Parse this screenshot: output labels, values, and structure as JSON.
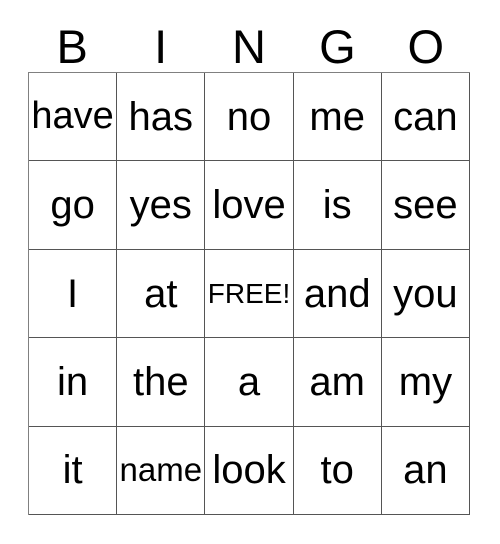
{
  "card": {
    "header_letters": [
      "B",
      "I",
      "N",
      "G",
      "O"
    ],
    "free_space_label": "FREE!",
    "colors": {
      "background": "#ffffff",
      "text": "#000000",
      "grid_line": "#555555",
      "grid_line_outer": "#808080"
    },
    "rows": [
      {
        "cells": [
          {
            "text": "have",
            "free": false
          },
          {
            "text": "has",
            "free": false
          },
          {
            "text": "no",
            "free": false
          },
          {
            "text": "me",
            "free": false
          },
          {
            "text": "can",
            "free": false
          }
        ]
      },
      {
        "cells": [
          {
            "text": "go",
            "free": false
          },
          {
            "text": "yes",
            "free": false
          },
          {
            "text": "love",
            "free": false
          },
          {
            "text": "is",
            "free": false
          },
          {
            "text": "see",
            "free": false
          }
        ]
      },
      {
        "cells": [
          {
            "text": "I",
            "free": false
          },
          {
            "text": "at",
            "free": false
          },
          {
            "text": "FREE!",
            "free": true
          },
          {
            "text": "and",
            "free": false
          },
          {
            "text": "you",
            "free": false
          }
        ]
      },
      {
        "cells": [
          {
            "text": "in",
            "free": false
          },
          {
            "text": "the",
            "free": false
          },
          {
            "text": "a",
            "free": false
          },
          {
            "text": "am",
            "free": false
          },
          {
            "text": "my",
            "free": false
          }
        ]
      },
      {
        "cells": [
          {
            "text": "it",
            "free": false
          },
          {
            "text": "name",
            "free": false
          },
          {
            "text": "look",
            "free": false
          },
          {
            "text": "to",
            "free": false
          },
          {
            "text": "an",
            "free": false
          }
        ]
      }
    ]
  }
}
